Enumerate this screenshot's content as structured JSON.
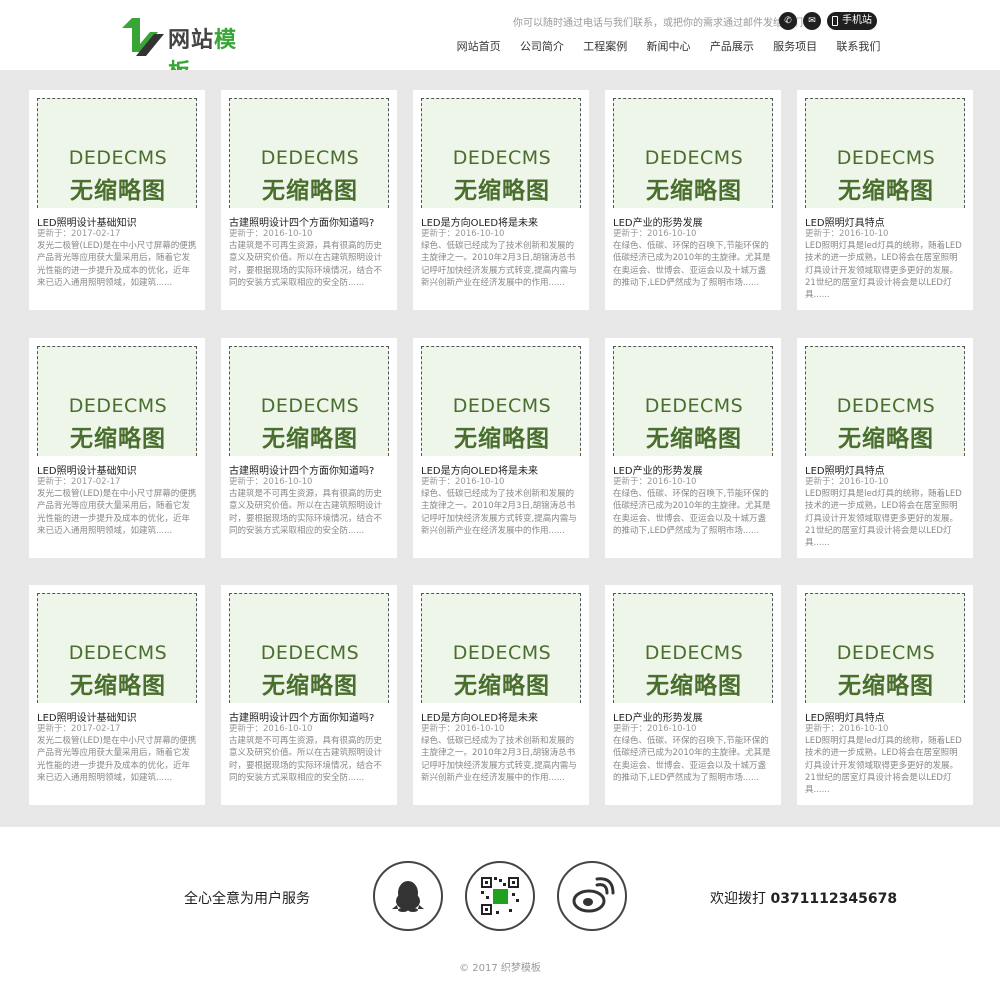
{
  "header": {
    "logo_text_a": "网站",
    "logo_text_b": "模板",
    "slogan": "你可以随时通过电话与我们联系，或把你的需求通过邮件发给我们!",
    "phone_icon": "phone-icon",
    "mail_icon": "mail-icon",
    "mobile_label": "手机站",
    "nav": [
      "网站首页",
      "公司简介",
      "工程案例",
      "新闻中心",
      "产品展示",
      "服务项目",
      "联系我们"
    ]
  },
  "thumb": {
    "line1": "DEDECMS",
    "line2": "无缩略图"
  },
  "articles": [
    {
      "title": "LED照明设计基础知识",
      "date": "更新于：2017-02-17",
      "desc": "发光二极管(LED)是在中小尺寸屏幕的便携产品背光等应用获大量采用后，随着它发光性能的进一步提升及成本的优化，近年来已迈入通用照明领域，如建筑......"
    },
    {
      "title": "古建照明设计四个方面你知道吗?",
      "date": "更新于：2016-10-10",
      "desc": "古建筑是不可再生资源，具有很高的历史意义及研究价值。所以在古建筑照明设计时，要根据现场的实际环境情况，结合不同的安装方式采取相应的安全防......"
    },
    {
      "title": "LED是方向OLED将是未来",
      "date": "更新于：2016-10-10",
      "desc": "绿色、低碳已经成为了技术创新和发展的主旋律之一。2010年2月3日,胡锦涛总书记呼吁加快经济发展方式转变,提高内需与新兴创新产业在经济发展中的作用......"
    },
    {
      "title": "LED产业的形势发展",
      "date": "更新于：2016-10-10",
      "desc": "在绿色、低碳、环保的召唤下,节能环保的低碳经济已成为2010年的主旋律。尤其是在奥运会、世博会、亚运会以及十城万盏的推动下,LED俨然成为了照明市场......"
    },
    {
      "title": "LED照明灯具特点",
      "date": "更新于：2016-10-10",
      "desc": "LED照明灯具是led灯具的统称，随着LED技术的进一步成熟，LED将会在居室照明灯具设计开发领域取得更多更好的发展。21世纪的居室灯具设计将会是以LED灯具......"
    }
  ],
  "footer": {
    "left_text": "全心全意为用户服务",
    "qq_icon": "qq-penguin-icon",
    "qr_icon": "qr-code-icon",
    "weibo_icon": "weibo-icon",
    "call_label": "欢迎拨打",
    "phone_number": "0371112345678",
    "copyright": "© 2017 织梦模板"
  },
  "colors": {
    "brand_green": "#3aa537",
    "grid_bg": "#e8e8e8",
    "thumb_bg": "#eef6ea",
    "thumb_text": "#4a6e2e"
  }
}
